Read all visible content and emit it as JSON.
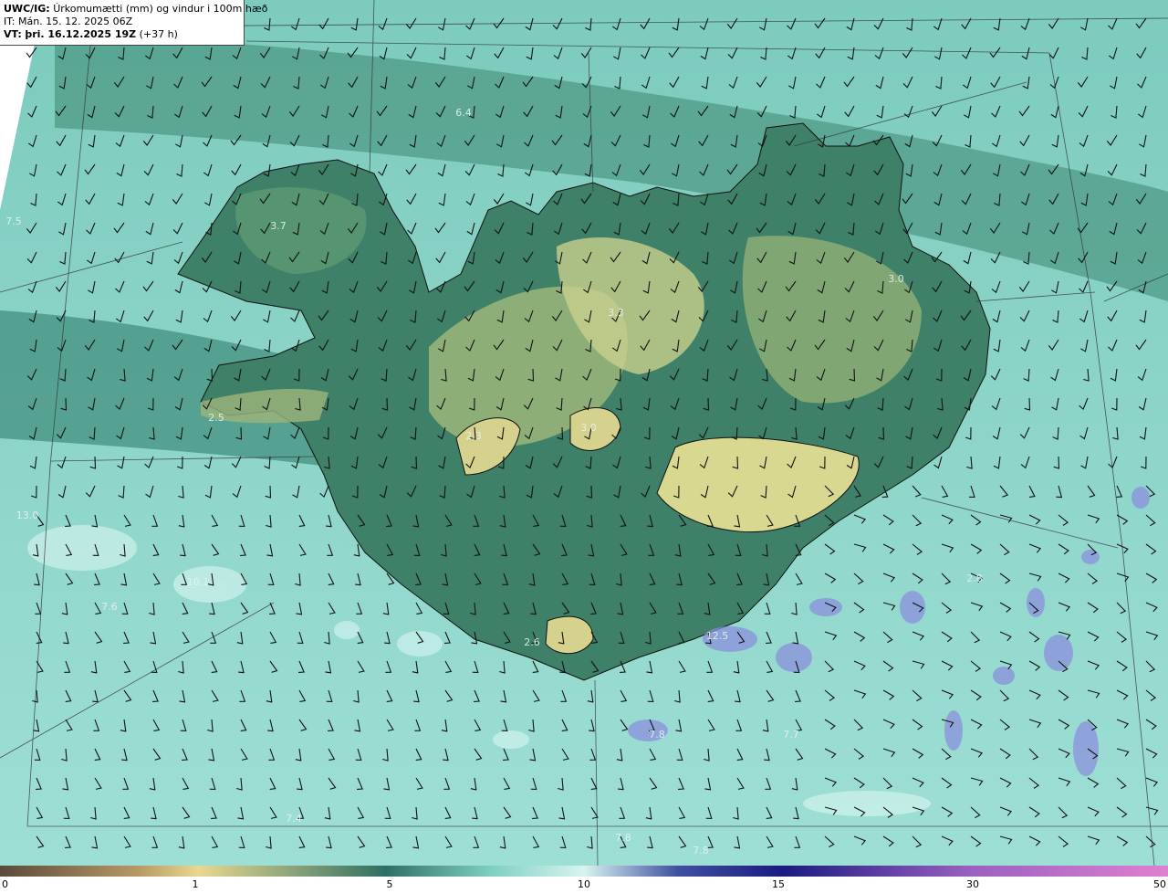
{
  "header": {
    "model_tag": "UWC/IG:",
    "title": "Úrkomumætti (mm) og vindur i 100m hæð",
    "issue_time": "IT: Mán. 15. 12. 2025 06Z",
    "valid_tag": "VT:",
    "valid_time": "þri. 16.12.2025 19Z",
    "lead": "(+37 h)"
  },
  "colorbar": {
    "ticks": [
      "0",
      "1",
      "5",
      "10",
      "15",
      "30",
      "50"
    ],
    "colors": [
      "#5a4a3a",
      "#b89a66",
      "#e8d890",
      "#2f6f63",
      "#7fcfc0",
      "#d8f4f0",
      "#4050a0",
      "#1a1a80",
      "#9a60c0",
      "#e080d0"
    ]
  },
  "map_labels": [
    {
      "text": "6.4"
    },
    {
      "text": "7.5"
    },
    {
      "text": "3.7"
    },
    {
      "text": "3.0"
    },
    {
      "text": "3.3"
    },
    {
      "text": "2.5"
    },
    {
      "text": "2.3"
    },
    {
      "text": "3.0"
    },
    {
      "text": "2.6"
    },
    {
      "text": "10.1"
    },
    {
      "text": "7.6"
    },
    {
      "text": "2.8"
    },
    {
      "text": "7.8"
    },
    {
      "text": "12.5"
    },
    {
      "text": "7.7"
    },
    {
      "text": "7.4"
    },
    {
      "text": "7.8"
    },
    {
      "text": "7.8"
    },
    {
      "text": "13.0"
    }
  ],
  "map_colors": {
    "ocean_light": "#8fd6cc",
    "ocean_dark": "#3f8a7a",
    "land_dark": "#2f6f5c",
    "land_mid": "#5e9a6a",
    "highland": "#c6cf88",
    "heavy_precip": "#8088d8",
    "coast": "#111111"
  }
}
